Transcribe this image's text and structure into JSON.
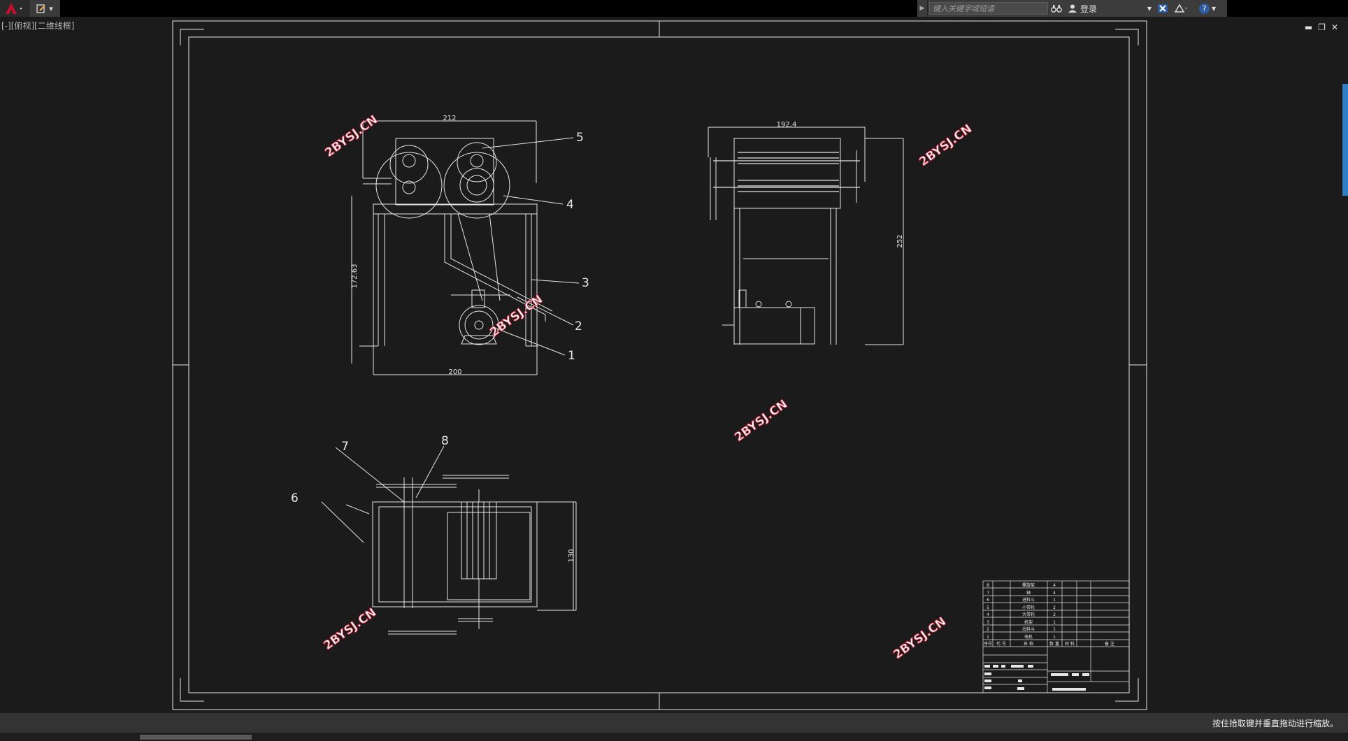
{
  "titlebar": {
    "quick_access_label": "▾",
    "search_placeholder": "键入关键字或短语",
    "login_label": "登录",
    "help_label": "?"
  },
  "viewport": {
    "label": "[-][俯视][二维线框]"
  },
  "drawing": {
    "watermark": "2BYSJ.CN",
    "front_view": {
      "dim_width_top": "212",
      "dim_height": "172.63",
      "dim_width_bottom": "200",
      "callouts": [
        "5",
        "4",
        "3",
        "2",
        "1"
      ]
    },
    "side_view": {
      "dim_width": "192.4",
      "dim_height": "252"
    },
    "top_view": {
      "dim_height": "130",
      "callouts": [
        "7",
        "8",
        "6"
      ]
    },
    "parts_list": [
      {
        "no": "8",
        "name": "螺旋桨",
        "qty": "4"
      },
      {
        "no": "7",
        "name": "轴",
        "qty": "4"
      },
      {
        "no": "6",
        "name": "进料斗",
        "qty": "1"
      },
      {
        "no": "5",
        "name": "小带轮",
        "qty": "2"
      },
      {
        "no": "4",
        "name": "大带轮",
        "qty": "2"
      },
      {
        "no": "3",
        "name": "机架",
        "qty": "1"
      },
      {
        "no": "2",
        "name": "出料斗",
        "qty": "1"
      },
      {
        "no": "1",
        "name": "电机",
        "qty": "1"
      }
    ],
    "parts_header": [
      "序号",
      "代 号",
      "名  称",
      "数 量",
      "材 料",
      "备  注"
    ]
  },
  "status": {
    "message": "按住拾取键并垂直拖动进行缩放。"
  },
  "colors": {
    "canvas": "#1b1b1b",
    "line": "#e6e6e6",
    "watermark": "#d8253a",
    "scroll_accent": "#2f7fc6"
  }
}
